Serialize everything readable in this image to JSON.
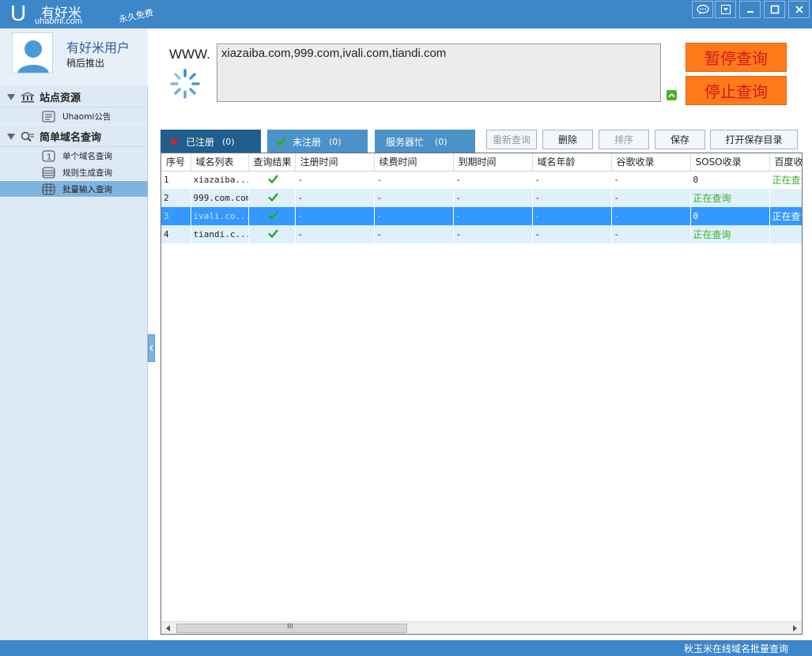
{
  "app": {
    "logo_letter": "U",
    "name": "有好米",
    "url": "uhaomi.com",
    "free_tag": "永久免费"
  },
  "window_controls": [
    "chat-icon",
    "menu-icon",
    "minimize-icon",
    "maximize-icon",
    "close-icon"
  ],
  "user": {
    "name": "有好米用户",
    "subtitle": "稍后推出"
  },
  "sidebar": {
    "groups": [
      {
        "label": "站点资源",
        "icon": "bank-icon",
        "items": [
          {
            "label": "Uhaomi公告",
            "icon": "notice-icon"
          }
        ]
      },
      {
        "label": "简单域名查询",
        "icon": "search-icon",
        "items": [
          {
            "label": "单个域名查询",
            "icon": "single-icon"
          },
          {
            "label": "规则生成查询",
            "icon": "list-icon"
          },
          {
            "label": "批量输入查询",
            "icon": "grid-icon",
            "active": true
          }
        ]
      }
    ]
  },
  "query": {
    "prefix": "WWW.",
    "input_value": "xiazaiba.com,999.com,ivali.com,tiandi.com",
    "pause_label": "暂停查询",
    "stop_label": "停止查询"
  },
  "tabs": [
    {
      "label": "已注册",
      "count": "(0)",
      "icon": "x-icon"
    },
    {
      "label": "未注册",
      "count": "(0)",
      "icon": "check-icon"
    },
    {
      "label": "服务器忙",
      "count": "(0)"
    }
  ],
  "toolbar": {
    "requery": "重新查询",
    "delete": "删除",
    "sort": "排序",
    "save": "保存",
    "open_dir": "打开保存目录"
  },
  "table": {
    "headers": [
      "序号",
      "域名列表",
      "查询结果",
      "注册时间",
      "续费时间",
      "到期时间",
      "域名年龄",
      "谷歌收录",
      "SOSO收录",
      "百度收"
    ],
    "rows": [
      {
        "no": "1",
        "domain": "xiazaiba...",
        "reg": "-",
        "renew": "-",
        "expire": "-",
        "age": "-",
        "google": "-",
        "soso": "0",
        "baidu": "正在查询"
      },
      {
        "no": "2",
        "domain": "999.com.com",
        "reg": "-",
        "renew": "-",
        "expire": "-",
        "age": "-",
        "google": "-",
        "soso": "正在查询",
        "baidu": ""
      },
      {
        "no": "3",
        "domain": "ivali.co...",
        "reg": "-",
        "renew": "-",
        "expire": "-",
        "age": "-",
        "google": "-",
        "soso": "0",
        "baidu": "正在查询"
      },
      {
        "no": "4",
        "domain": "tiandi.c...",
        "reg": "-",
        "renew": "-",
        "expire": "-",
        "age": "-",
        "google": "-",
        "soso": "正在查询",
        "baidu": ""
      }
    ],
    "scroll_label": "III"
  },
  "status": {
    "text": "秋玉米在线域名批量查询"
  },
  "colors": {
    "accent": "#3d86c8",
    "orange": "#ff7a1a",
    "red_text": "#d21b1b",
    "selected": "#3399ff",
    "green": "#3aae26"
  }
}
